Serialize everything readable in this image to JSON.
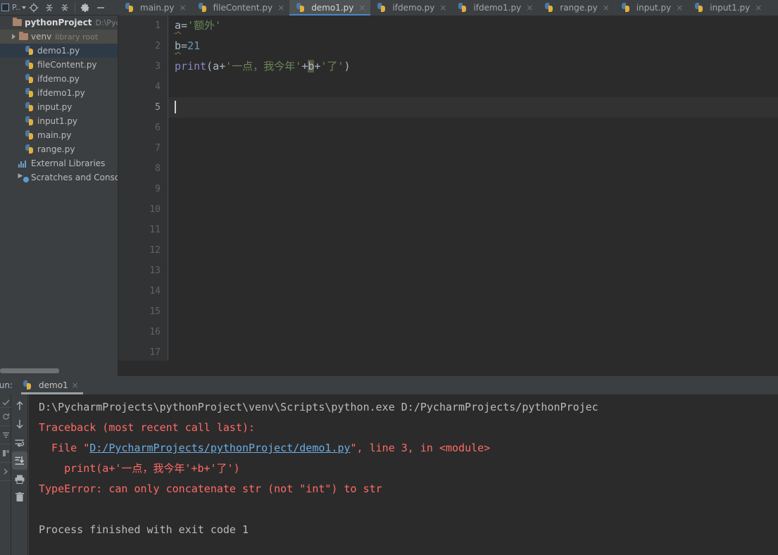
{
  "toolbar": {
    "project_selector_label": "P..",
    "buttons": [
      {
        "name": "locate-icon",
        "title": "Select Opened File"
      },
      {
        "name": "expand-all-icon",
        "title": "Expand All"
      },
      {
        "name": "collapse-all-icon",
        "title": "Collapse All"
      },
      {
        "name": "gear-icon",
        "title": "Settings"
      },
      {
        "name": "minimize-icon",
        "title": "Hide"
      }
    ]
  },
  "sidebar": {
    "items": [
      {
        "label": "pythonProject",
        "sub": "D:\\Pycha",
        "icon": "folder-icon",
        "kind": "root",
        "indent": 0,
        "state": "normal"
      },
      {
        "label": "venv",
        "sub": "library root",
        "icon": "folder-icon",
        "kind": "folder",
        "indent": 1,
        "state": "hover"
      },
      {
        "label": "demo1.py",
        "sub": "",
        "icon": "python-file-icon",
        "kind": "file",
        "indent": 2,
        "state": "selected"
      },
      {
        "label": "fileContent.py",
        "sub": "",
        "icon": "python-file-icon",
        "kind": "file",
        "indent": 2,
        "state": "normal"
      },
      {
        "label": "ifdemo.py",
        "sub": "",
        "icon": "python-file-icon",
        "kind": "file",
        "indent": 2,
        "state": "normal"
      },
      {
        "label": "ifdemo1.py",
        "sub": "",
        "icon": "python-file-icon",
        "kind": "file",
        "indent": 2,
        "state": "normal"
      },
      {
        "label": "input.py",
        "sub": "",
        "icon": "python-file-icon",
        "kind": "file",
        "indent": 2,
        "state": "normal"
      },
      {
        "label": "input1.py",
        "sub": "",
        "icon": "python-file-icon",
        "kind": "file",
        "indent": 2,
        "state": "normal"
      },
      {
        "label": "main.py",
        "sub": "",
        "icon": "python-file-icon",
        "kind": "file",
        "indent": 2,
        "state": "normal"
      },
      {
        "label": "range.py",
        "sub": "",
        "icon": "python-file-icon",
        "kind": "file",
        "indent": 2,
        "state": "normal"
      },
      {
        "label": "External Libraries",
        "sub": "",
        "icon": "external-libraries-icon",
        "kind": "node",
        "indent": 1,
        "state": "normal"
      },
      {
        "label": "Scratches and Consoles",
        "sub": "",
        "icon": "scratches-icon",
        "kind": "node",
        "indent": 1,
        "state": "normal"
      }
    ]
  },
  "tabs": [
    {
      "label": "main.py",
      "active": false
    },
    {
      "label": "fileContent.py",
      "active": false
    },
    {
      "label": "demo1.py",
      "active": true
    },
    {
      "label": "ifdemo.py",
      "active": false
    },
    {
      "label": "ifdemo1.py",
      "active": false
    },
    {
      "label": "range.py",
      "active": false
    },
    {
      "label": "input.py",
      "active": false
    },
    {
      "label": "input1.py",
      "active": false
    }
  ],
  "editor": {
    "line_numbers": [
      "1",
      "2",
      "3",
      "4",
      "5",
      "6",
      "7",
      "8",
      "9",
      "10",
      "11",
      "12",
      "13",
      "14",
      "15",
      "16",
      "17"
    ],
    "current_line": 5,
    "code": {
      "line1_var": "a",
      "line1_eq": "=",
      "line1_str": "'额外'",
      "line2_var": "b",
      "line2_eq": "=",
      "line2_num": "21",
      "line3_fn": "print",
      "line3_p1": "(a+",
      "line3_str1": "'一点，我今年'",
      "line3_plus1": "+",
      "line3_b": "b",
      "line3_plus2": "+",
      "line3_str2": "'了'",
      "line3_p2": ")"
    }
  },
  "run_panel": {
    "label": "Run:",
    "tab_label": "demo1",
    "close_label": "×",
    "toolbar_icons": [
      {
        "name": "up-arrow-icon",
        "active": false
      },
      {
        "name": "down-arrow-icon",
        "active": false
      },
      {
        "name": "soft-wrap-icon",
        "active": false
      },
      {
        "name": "scroll-to-end-icon",
        "active": true
      },
      {
        "name": "print-icon",
        "active": false
      },
      {
        "name": "trash-icon",
        "active": false
      }
    ],
    "console": [
      {
        "type": "cmd",
        "text": "D:\\PycharmProjects\\pythonProject\\venv\\Scripts\\python.exe D:/PycharmProjects/pythonProjec"
      },
      {
        "type": "err",
        "text": "Traceback (most recent call last):"
      },
      {
        "type": "err_link",
        "pre": "  File \"",
        "link": "D:/PycharmProjects/pythonProject/demo1.py",
        "post": "\", line 3, in <module>"
      },
      {
        "type": "err",
        "text": "    print(a+'一点，我今年'+b+'了')"
      },
      {
        "type": "err",
        "text": "TypeError: can only concatenate str (not \"int\") to str"
      },
      {
        "type": "blank",
        "text": ""
      },
      {
        "type": "out",
        "text": "Process finished with exit code 1"
      }
    ]
  },
  "colors": {
    "bg_panel": "#3c3f41",
    "bg_editor": "#2b2b2b",
    "accent_tab": "#4a88c7",
    "string_green": "#6a8759",
    "number_blue": "#6897bb",
    "function_violet": "#8888c6",
    "error_red": "#ff6b68",
    "link_blue": "#6cace4"
  }
}
